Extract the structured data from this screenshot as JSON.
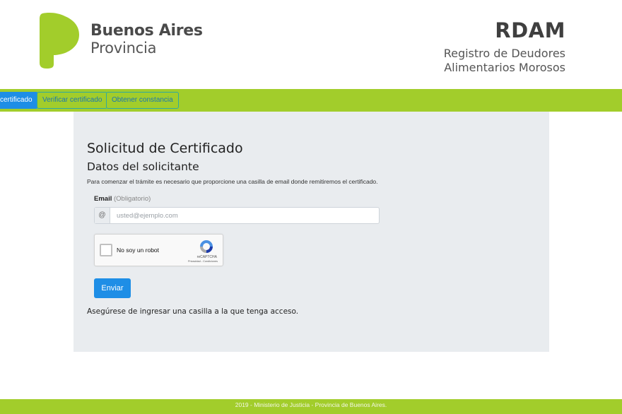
{
  "header": {
    "brand_line1": "Buenos Aires",
    "brand_line2": "Provincia",
    "system_title": "RDAM",
    "system_subtitle_line1": "Registro de Deudores",
    "system_subtitle_line2": "Alimentarios Morosos"
  },
  "nav": {
    "tabs": [
      {
        "label": "certificado",
        "active": true
      },
      {
        "label": "Verificar certificado",
        "active": false
      },
      {
        "label": "Obtener constancia",
        "active": false
      }
    ]
  },
  "form": {
    "title": "Solicitud de Certificado",
    "section": "Datos del solicitante",
    "intro": "Para comenzar el trámite es necesario que proporcione una casilla de email donde remitiremos el certificado.",
    "email_label": "Email",
    "email_required": "(Obligatorio)",
    "email_prefix": "@",
    "email_value": "",
    "email_placeholder": "usted@ejemplo.com",
    "captcha_text": "No soy un robot",
    "captcha_brand": "reCAPTCHA",
    "captcha_links": "Privacidad - Condiciones",
    "submit_label": "Enviar",
    "note": "Asegúrese de ingresar una casilla a la que tenga acceso."
  },
  "footer": {
    "text": "2019 - Ministerio de Justicia - Provincia de Buenos Aires."
  },
  "colors": {
    "brand_green": "#a2cd2b",
    "primary_blue": "#1e8ee6",
    "panel_gray": "#e9ecef"
  }
}
